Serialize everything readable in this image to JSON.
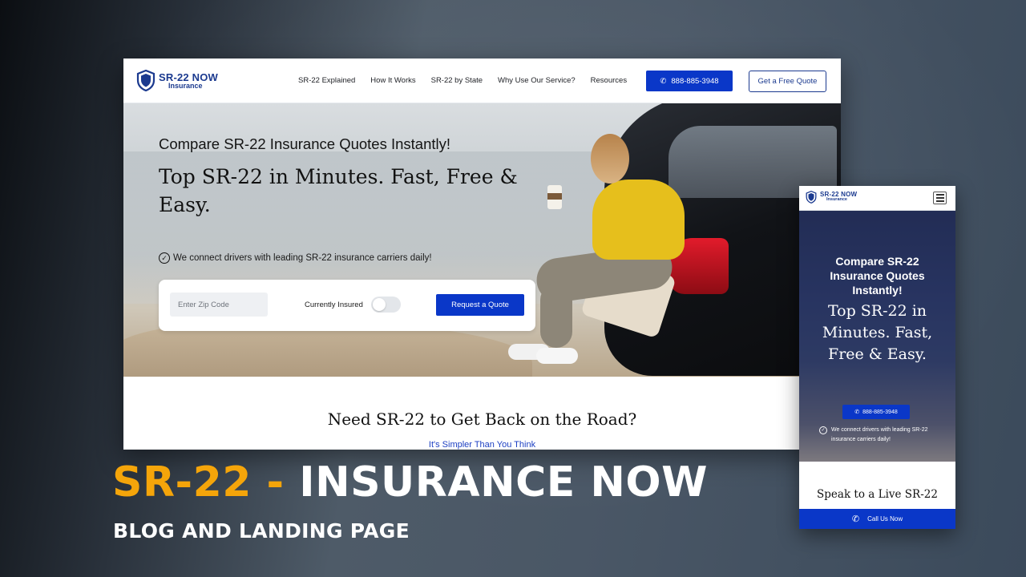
{
  "colors": {
    "brand_blue": "#0a37c8",
    "logo_blue": "#1b3a8f",
    "accent_orange": "#f5a50a"
  },
  "desktop": {
    "logo": {
      "line1": "SR-22 NOW",
      "line2": "Insurance"
    },
    "nav": {
      "items": [
        "SR-22 Explained",
        "How It Works",
        "SR-22 by State",
        "Why Use Our Service?",
        "Resources"
      ],
      "phone_label": "888-885-3948",
      "quote_label": "Get a Free Quote"
    },
    "hero": {
      "subtitle": "Compare SR-22 Insurance Quotes Instantly!",
      "title": "Top SR-22 in Minutes. Fast, Free & Easy.",
      "check_text": "We connect drivers with leading SR-22 insurance carriers daily!",
      "form": {
        "zip_placeholder": "Enter Zip Code",
        "insured_label": "Currently Insured",
        "insured_on": false,
        "submit_label": "Request a Quote"
      }
    },
    "section": {
      "title": "Need SR-22 to Get Back on the Road?",
      "subtitle": "It's Simpler Than You Think"
    }
  },
  "mobile": {
    "logo": {
      "line1": "SR-22 NOW",
      "line2": "Insurance"
    },
    "hero": {
      "subtitle": "Compare SR-22 Insurance Quotes Instantly!",
      "title": "Top SR-22 in Minutes. Fast, Free & Easy.",
      "phone_label": "888-885-3948",
      "check_text": "We connect drivers with leading SR-22 insurance carriers daily!"
    },
    "speak_title": "Speak to a Live SR-22",
    "call_bar_label": "Call Us Now"
  },
  "caption": {
    "main_accent": "SR-22 -",
    "main_rest": "INSURANCE NOW",
    "sub": "BLOG AND LANDING PAGE"
  },
  "icons": {
    "phone": "phone-icon",
    "check": "check-circle-icon",
    "menu": "hamburger-menu-icon",
    "shield": "shield-logo-icon"
  }
}
